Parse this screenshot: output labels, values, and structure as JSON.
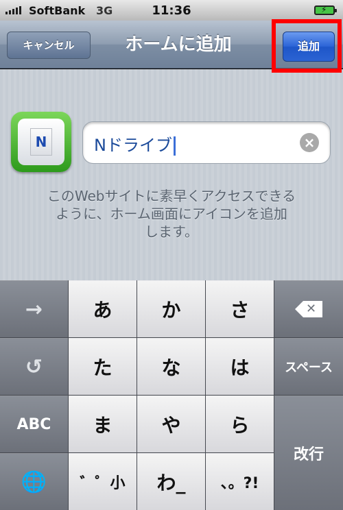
{
  "status_bar": {
    "carrier": "SoftBank",
    "network": "3G",
    "time": "11:36"
  },
  "nav": {
    "cancel_label": "キャンセル",
    "title": "ホームに追加",
    "add_label": "追加"
  },
  "content": {
    "icon_letter": "N",
    "name_value": "Nドライブ",
    "hint_lines": [
      "このWebサイトに素早くアクセスできる",
      "ように、ホーム画面にアイコンを追加",
      "します。"
    ]
  },
  "keyboard": {
    "row1": [
      "あ",
      "か",
      "さ"
    ],
    "row2": [
      "た",
      "な",
      "は"
    ],
    "row3": [
      "ま",
      "や",
      "ら"
    ],
    "row4": [
      "゛゜小",
      "わ_",
      "、。?!"
    ],
    "abc_label": "ABC",
    "space_label": "スペース",
    "return_label": "改行",
    "icons": {
      "next": "arrow-right-icon",
      "undo": "undo-icon",
      "globe": "globe-icon",
      "delete": "backspace-icon"
    }
  },
  "colors": {
    "highlight": "#ff0000",
    "add_button": "#2a63d6",
    "battery": "#46c446"
  }
}
